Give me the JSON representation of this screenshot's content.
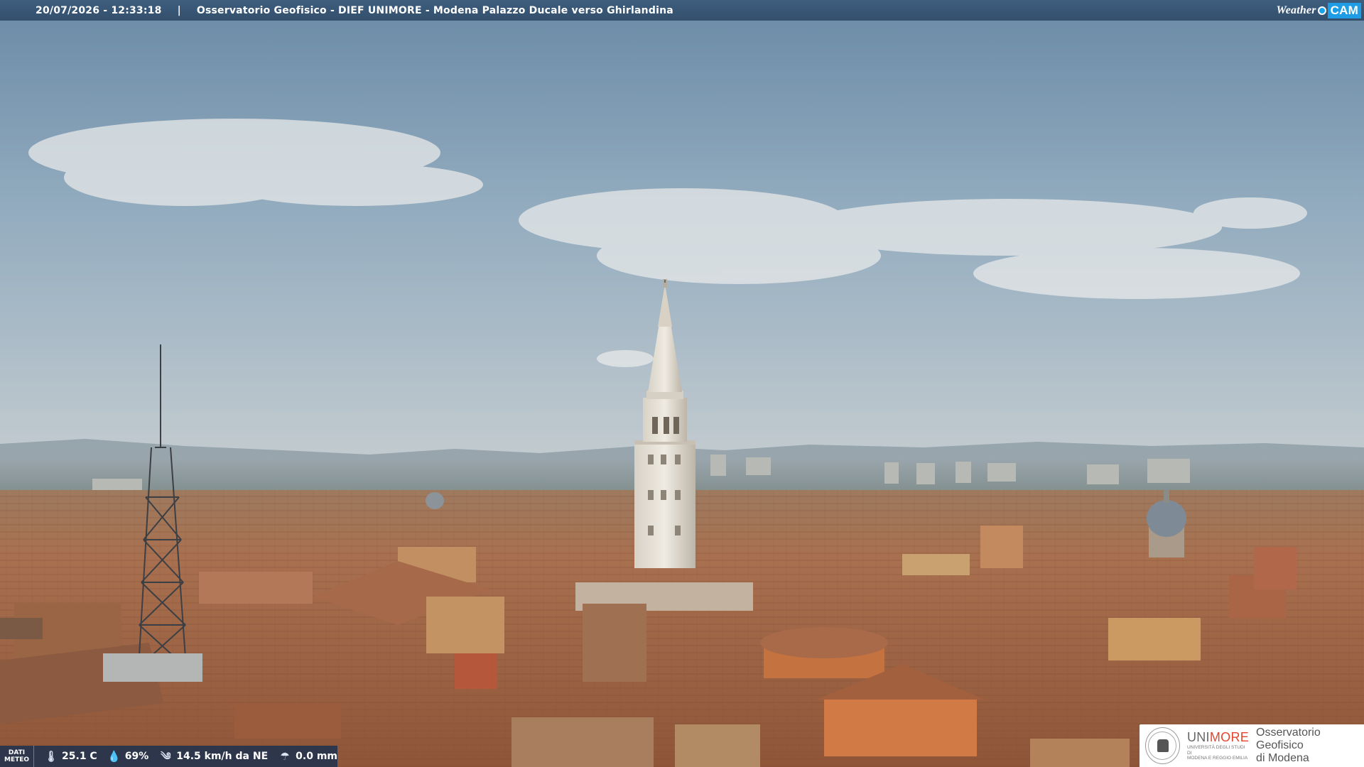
{
  "header": {
    "datetime": "20/07/2026 - 12:33:18",
    "separator": "|",
    "title": "Osservatorio Geofisico - DIEF UNIMORE - Modena Palazzo Ducale verso Ghirlandina",
    "brand_weather": "Weather",
    "brand_cam": "CAM"
  },
  "weather": {
    "label_line1": "DATI",
    "label_line2": "METEO",
    "temperature": "25.1 C",
    "humidity": "69%",
    "wind": "14.5 km/h da NE",
    "rain": "0.0 mm"
  },
  "logo": {
    "uni_part1": "UNI",
    "uni_part2": "MORE",
    "uni_sub1": "UNIVERSITÀ DEGLI STUDI DI",
    "uni_sub2": "MODENA E REGGIO EMILIA",
    "osservatorio_line1": "Osservatorio Geofisico",
    "osservatorio_line2": "di Modena"
  },
  "colors": {
    "banner": "#3a5a7a",
    "sky_top": "#6f8fa8",
    "roof": "#b06a45",
    "unimore_accent": "#e2462c"
  },
  "icons": [
    "thermometer-icon",
    "humidity-icon",
    "wind-icon",
    "rain-icon",
    "webcam-brand-icon",
    "university-seal-icon"
  ]
}
